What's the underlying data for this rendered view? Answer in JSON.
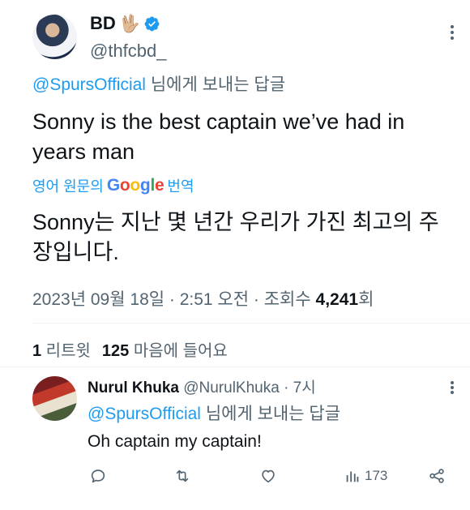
{
  "post": {
    "author_name": "BD",
    "author_emoji": "🖖🏼",
    "author_handle": "@thfcbd_",
    "reply_mention": "@SpursOfficial",
    "reply_suffix": " 님에게 보내는 답글",
    "text": "Sonny is the best captain we’ve had in years man",
    "translate_prefix": "영어 원문의",
    "translate_suffix": "번역",
    "translated_text": "Sonny는 지난 몇 년간 우리가 가진 최고의 주장입니다.",
    "timestamp": "2023년 09월 18일 · 2:51 오전 · 조회수 ",
    "views": "4,241",
    "views_suffix": "회",
    "retweets": "1",
    "retweets_label": " 리트윗",
    "likes": "125",
    "likes_label": " 마음에 들어요"
  },
  "reply": {
    "author_name": "Nurul Khuka",
    "author_meta": " @NurulKhuka · 7시",
    "reply_mention": "@SpursOfficial",
    "reply_suffix": " 님에게 보내는 답글",
    "text": "Oh captain my captain!",
    "views": "173"
  },
  "colors": {
    "accent": "#1d9bf0",
    "secondary_text": "#536471",
    "primary_text": "#0f1419"
  }
}
